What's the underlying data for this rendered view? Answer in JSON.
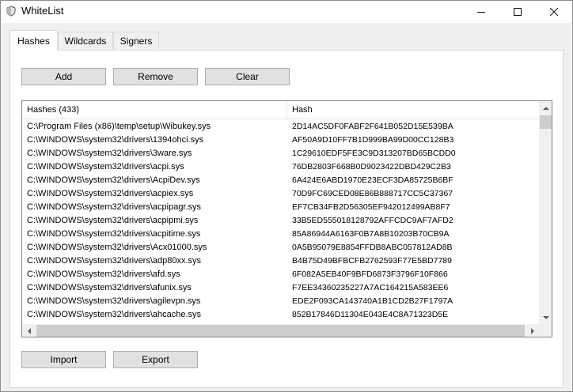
{
  "window": {
    "title": "WhiteList",
    "icon": "shield-icon"
  },
  "tabs": [
    {
      "label": "Hashes",
      "active": true
    },
    {
      "label": "Wildcards",
      "active": false
    },
    {
      "label": "Signers",
      "active": false
    }
  ],
  "toolbar": {
    "add_label": "Add",
    "remove_label": "Remove",
    "clear_label": "Clear"
  },
  "list": {
    "columns": [
      "Hashes (433)",
      "Hash"
    ],
    "rows": [
      {
        "path": "C:\\Program Files (x86)\\temp\\setup\\Wibukey.sys",
        "hash": "2D14AC5DF0FABF2F641B052D15E539BA"
      },
      {
        "path": "C:\\WINDOWS\\system32\\drivers\\1394ohci.sys",
        "hash": "AF50A9D10FF7B1D999BA99D00CC128B3"
      },
      {
        "path": "C:\\WINDOWS\\system32\\drivers\\3ware.sys",
        "hash": "1C29610EDF5FE3C9D313207BD65BCDD0"
      },
      {
        "path": "C:\\WINDOWS\\system32\\drivers\\acpi.sys",
        "hash": "76DB2803F668B0D9023422DBD429C2B3"
      },
      {
        "path": "C:\\WINDOWS\\system32\\drivers\\AcpiDev.sys",
        "hash": "6A424E6ABD1970E23ECF3DA85725B6BF"
      },
      {
        "path": "C:\\WINDOWS\\system32\\drivers\\acpiex.sys",
        "hash": "70D9FC69CED08E86B888717CC5C37367"
      },
      {
        "path": "C:\\WINDOWS\\system32\\drivers\\acpipagr.sys",
        "hash": "EF7CB34FB2D56305EF942012499AB8F7"
      },
      {
        "path": "C:\\WINDOWS\\system32\\drivers\\acpipmi.sys",
        "hash": "33B5ED555018128792AFFCDC9AF7AFD2"
      },
      {
        "path": "C:\\WINDOWS\\system32\\drivers\\acpitime.sys",
        "hash": "85A86944A6163F0B7A8B10203B70CB9A"
      },
      {
        "path": "C:\\WINDOWS\\system32\\drivers\\Acx01000.sys",
        "hash": "0A5B95079E8854FFDB8ABC057812AD8B"
      },
      {
        "path": "C:\\WINDOWS\\system32\\drivers\\adp80xx.sys",
        "hash": "B4B75D49BFBCFB2762593F77E5BD7789"
      },
      {
        "path": "C:\\WINDOWS\\system32\\drivers\\afd.sys",
        "hash": "6F082A5EB40F9BFD6873F3796F10F866"
      },
      {
        "path": "C:\\WINDOWS\\system32\\drivers\\afunix.sys",
        "hash": "F7EE34360235227A7AC164215A583EE6"
      },
      {
        "path": "C:\\WINDOWS\\system32\\drivers\\agilevpn.sys",
        "hash": "EDE2F093CA143740A1B1CD2B27F1797A"
      },
      {
        "path": "C:\\WINDOWS\\system32\\drivers\\ahcache.sys",
        "hash": "852B17846D11304E043E4C8A71323D5E"
      }
    ]
  },
  "footer": {
    "import_label": "Import",
    "export_label": "Export"
  },
  "colors": {
    "client_bg": "#f0f0f0",
    "button_bg": "#e1e1e1",
    "button_border": "#adadad",
    "scrollbar_thumb": "#cdcdcd"
  }
}
